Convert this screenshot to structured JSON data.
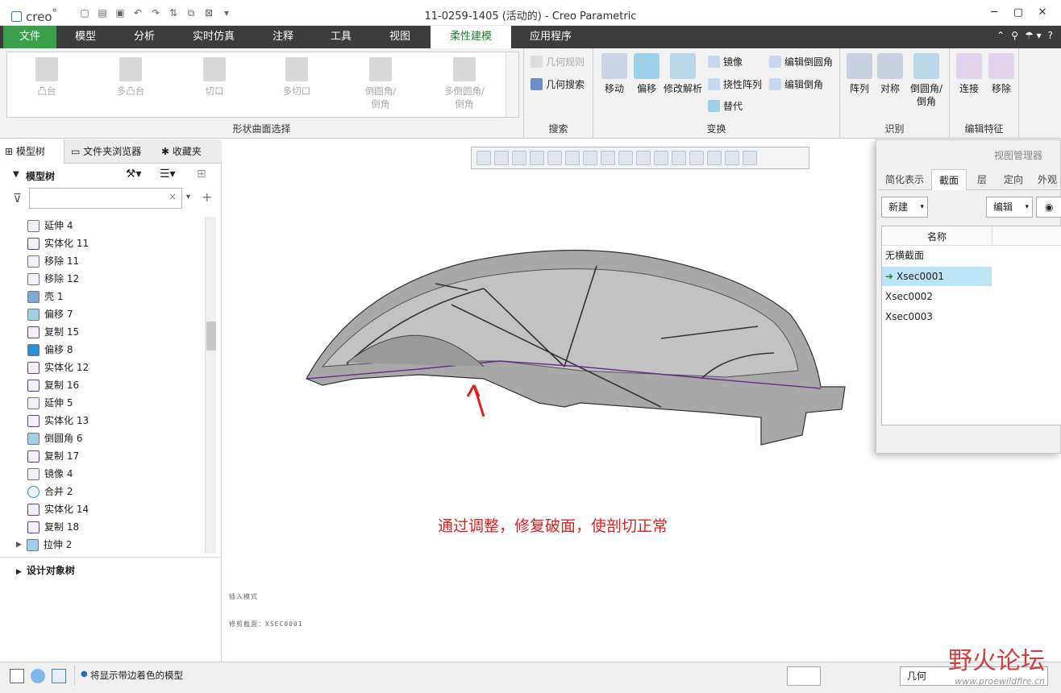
{
  "app": {
    "logo": "creo",
    "logo_mark": "°",
    "window_title": "11-0259-1405 (活动的) - Creo Parametric"
  },
  "qat": {
    "icons": [
      "new-icon",
      "open-icon",
      "save-icon",
      "undo-icon",
      "redo-icon",
      "regenerate-icon",
      "windows-icon",
      "close-icon",
      "customize-icon"
    ]
  },
  "window_controls": {
    "minimize": "─",
    "maximize": "▢",
    "close": "✕"
  },
  "menu": {
    "tabs": [
      "文件",
      "模型",
      "分析",
      "实时仿真",
      "注释",
      "工具",
      "视图",
      "柔性建模",
      "应用程序"
    ],
    "active": "柔性建模",
    "right_glyphs": [
      "⌃",
      "⚲",
      "☂ ▾",
      "?"
    ]
  },
  "ribbon": {
    "gallery": {
      "items": [
        "凸台",
        "多凸台",
        "切口",
        "多切口",
        "倒圆角/\n倒角",
        "多倒圆角/\n倒角"
      ],
      "group": "形状曲面选择"
    },
    "search": {
      "items": [
        "几何规则",
        "几何搜索"
      ],
      "group": "搜索"
    },
    "transform": {
      "large": [
        "移动",
        "偏移",
        "修改解析"
      ],
      "small": [
        "镜像",
        "挠性阵列",
        "替代",
        "编辑倒圆角",
        "编辑倒角"
      ],
      "group": "变换"
    },
    "recognize": {
      "items": [
        "阵列",
        "对称",
        "倒圆角/\n倒角"
      ],
      "group": "识别"
    },
    "edit": {
      "items": [
        "连接",
        "移除"
      ],
      "group": "编辑特征"
    }
  },
  "left_panel": {
    "tabs": [
      "模型树",
      "文件夹浏览器",
      "收藏夹"
    ],
    "tree_title": "模型树",
    "filter_placeholder": "",
    "items": [
      "延伸 4",
      "实体化 11",
      "移除 11",
      "移除 12",
      "壳 1",
      "偏移 7",
      "复制 15",
      "偏移 8",
      "实体化 12",
      "复制 16",
      "延伸 5",
      "实体化 13",
      "倒圆角 6",
      "复制 17",
      "镜像 4",
      "合并 2",
      "实体化 14",
      "复制 18",
      "拉伸 2"
    ],
    "design_tree": "设计对象树"
  },
  "view_manager": {
    "title": "视图管理器",
    "tabs": [
      "简化表示",
      "截面",
      "层",
      "定向",
      "外观"
    ],
    "active_tab": "截面",
    "new_label": "新建",
    "edit_label": "编辑",
    "column": "名称",
    "rows": [
      "无横截面",
      "Xsec0001",
      "Xsec0002",
      "Xsec0003"
    ],
    "selected": "Xsec0001"
  },
  "viewport": {
    "callout": "通过调整，修复破面，使剖切正常",
    "note1": "插入模式",
    "note2": "修剪截面：XSEC0001"
  },
  "status": {
    "message": "将显示带边着色的模型",
    "filter": "几何"
  },
  "watermark": {
    "cn": "野火论坛",
    "url": "www.proewildfire.cn"
  },
  "colors": {
    "accent_green": "#3aa04a",
    "menubar": "#3c3c3c",
    "selection": "#bde3f7",
    "callout_red": "#e02020"
  }
}
